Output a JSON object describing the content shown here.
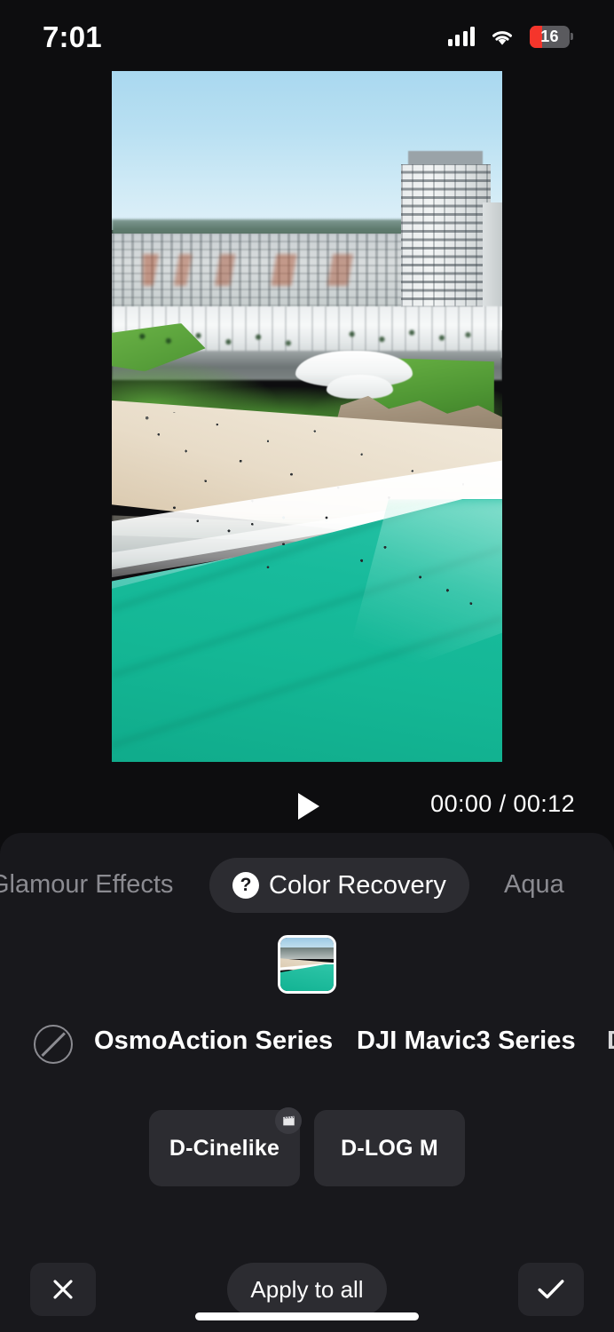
{
  "status_bar": {
    "time": "7:01",
    "cellular_icon": "cellular-signal-icon",
    "wifi_icon": "wifi-icon",
    "battery_level": "16",
    "battery_low": true,
    "battery_color": "#f5352b"
  },
  "preview": {
    "alt": "aerial-beach-video-frame"
  },
  "playback": {
    "play_icon": "play-icon",
    "current_time": "00:00",
    "separator": "/",
    "total_time": "00:12",
    "time_display": "00:00 / 00:12"
  },
  "tabs": [
    {
      "label": "Glamour Effects",
      "active": false,
      "icon": null
    },
    {
      "label": "Color Recovery",
      "active": true,
      "icon": "help-circle-icon"
    },
    {
      "label": "Aqua",
      "active": false,
      "icon": null
    }
  ],
  "clip_strip": {
    "selected_index": 0,
    "thumbnails": [
      {
        "name": "clip-thumbnail-1",
        "selected": true
      }
    ]
  },
  "series_row": {
    "none_option_icon": "no-effect-icon",
    "items": [
      {
        "label": "OsmoAction Series",
        "selected": false
      },
      {
        "label": "DJI Mavic3 Series",
        "selected": true
      },
      {
        "label": "D",
        "selected": false
      }
    ]
  },
  "profiles": [
    {
      "label": "D-Cinelike",
      "badge_icon": "clapperboard-icon",
      "selected": false
    },
    {
      "label": "D-LOG M",
      "badge_icon": null,
      "selected": false
    }
  ],
  "actions": {
    "cancel_icon": "close-icon",
    "apply_all_label": "Apply to all",
    "confirm_icon": "check-icon"
  },
  "colors": {
    "page_background": "#0d0d0f",
    "panel_background": "#18181c",
    "chip_background": "#2c2c31",
    "text_primary": "#ffffff",
    "text_muted": "#8b8b91"
  }
}
